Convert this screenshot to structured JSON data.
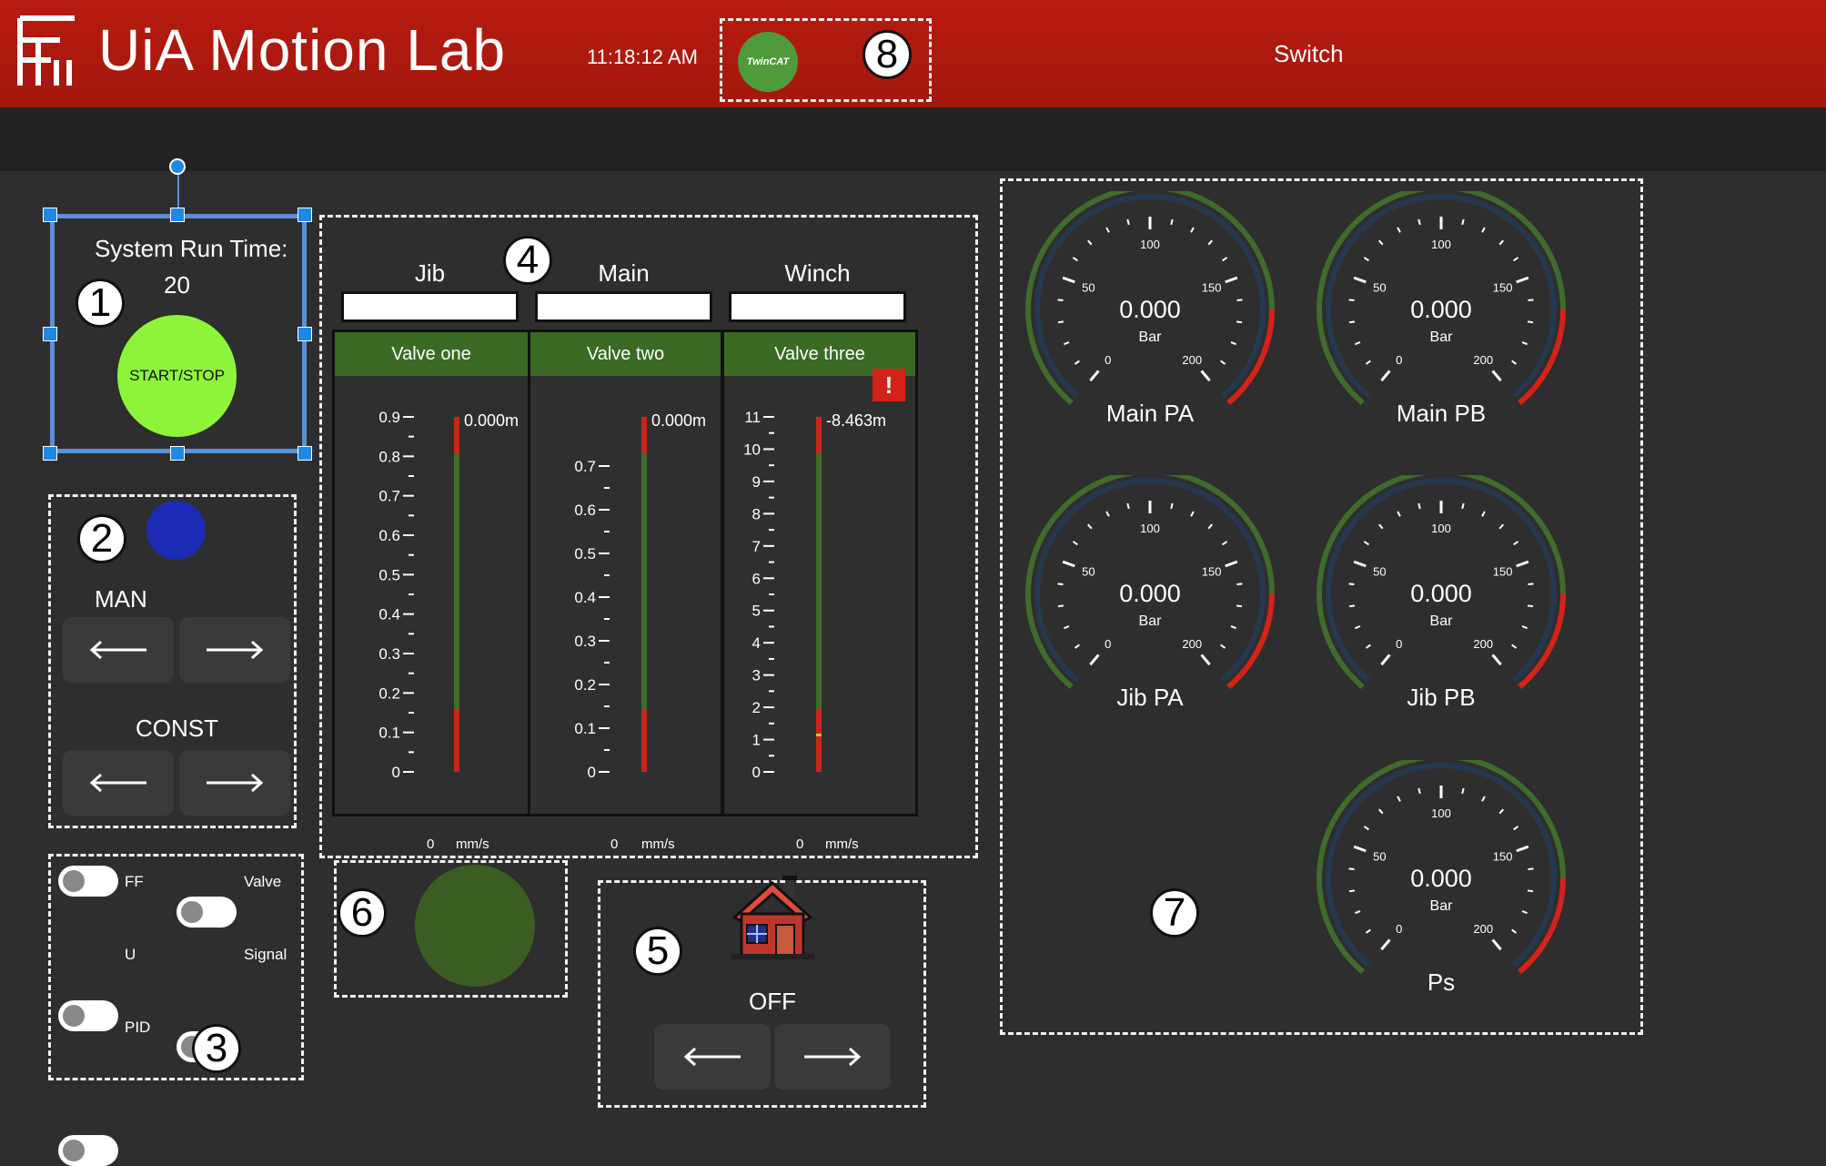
{
  "header": {
    "app_title": "UiA Motion Lab",
    "clock": "11:18:12 AM",
    "twincat_label": "TwinCAT",
    "switch_label": "Switch",
    "brand_color": "#b01a0f"
  },
  "badges": [
    "1",
    "2",
    "3",
    "4",
    "5",
    "6",
    "7",
    "8"
  ],
  "system": {
    "run_time_label": "System Run Time:",
    "run_time_value": "20",
    "start_stop_label": "START/STOP"
  },
  "mode": {
    "man_label": "MAN",
    "const_label": "CONST"
  },
  "toggles": [
    {
      "label": "FF"
    },
    {
      "label": "Valve"
    },
    {
      "label": "U"
    },
    {
      "label": "Signal"
    },
    {
      "label": "PID"
    }
  ],
  "valves": [
    {
      "column": "Jib",
      "title": "Valve one",
      "reading": "0.000m",
      "speed": "0",
      "unit": "mm/s",
      "ticks": [
        "0.9",
        "0.8",
        "0.7",
        "0.6",
        "0.5",
        "0.4",
        "0.3",
        "0.2",
        "0.1",
        "0"
      ]
    },
    {
      "column": "Main",
      "title": "Valve two",
      "reading": "0.000m",
      "speed": "0",
      "unit": "mm/s",
      "ticks": [
        "0.7",
        "0.6",
        "0.5",
        "0.4",
        "0.3",
        "0.2",
        "0.1",
        "0"
      ]
    },
    {
      "column": "Winch",
      "title": "Valve three",
      "reading": "-8.463m",
      "speed": "0",
      "unit": "mm/s",
      "alert": "!",
      "ticks": [
        "11",
        "10",
        "9",
        "8",
        "7",
        "6",
        "5",
        "4",
        "3",
        "2",
        "1",
        "0"
      ]
    }
  ],
  "home": {
    "state": "OFF"
  },
  "gauges": [
    {
      "name": "Main PA",
      "value": "0.000",
      "unit": "Bar",
      "ticks": [
        "0",
        "50",
        "100",
        "150",
        "200"
      ]
    },
    {
      "name": "Main PB",
      "value": "0.000",
      "unit": "Bar",
      "ticks": [
        "0",
        "50",
        "100",
        "150",
        "200"
      ]
    },
    {
      "name": "Jib PA",
      "value": "0.000",
      "unit": "Bar",
      "ticks": [
        "0",
        "50",
        "100",
        "150",
        "200"
      ]
    },
    {
      "name": "Jib PB",
      "value": "0.000",
      "unit": "Bar",
      "ticks": [
        "0",
        "50",
        "100",
        "150",
        "200"
      ]
    },
    {
      "name": "Ps",
      "value": "0.000",
      "unit": "Bar",
      "ticks": [
        "0",
        "50",
        "100",
        "150",
        "200"
      ]
    }
  ],
  "colors": {
    "gauge_green": "#3f6b2b",
    "gauge_red": "#d42218",
    "indicator_blue": "#1b2bb3",
    "indicator_green": "#3a5e22",
    "start_green": "#8ef43a"
  }
}
